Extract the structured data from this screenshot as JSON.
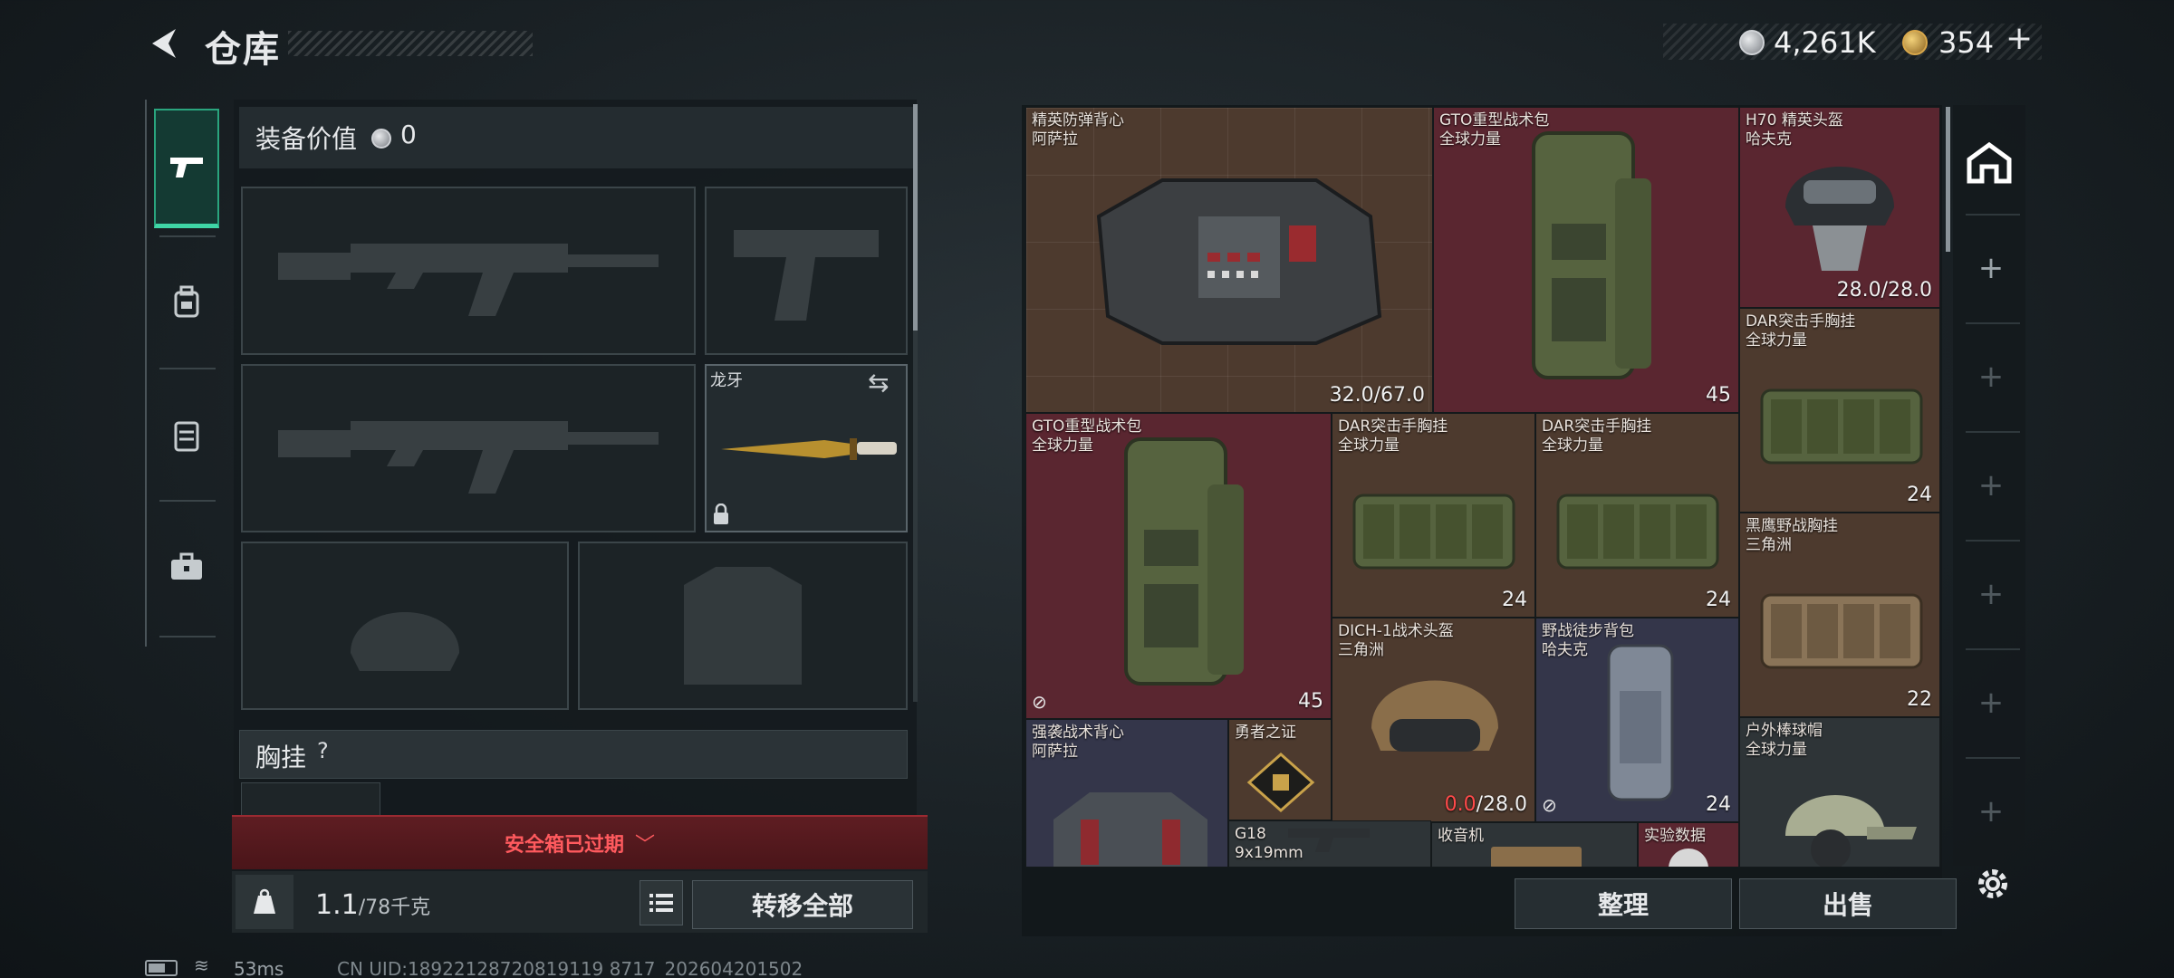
{
  "header": {
    "title": "仓库"
  },
  "currency": {
    "silver": "4,261K",
    "gold": "354",
    "plus": "+"
  },
  "equipment": {
    "value_label": "装备价值",
    "value": "0",
    "knife_name": "龙牙",
    "vest_label": "胸挂",
    "vest_help": "?",
    "safe_box_status": "安全箱已过期",
    "weight_current": "1.1",
    "weight_max": "/78千克",
    "transfer_all": "转移全部"
  },
  "stash": {
    "items": [
      {
        "name1": "精英防弹背心",
        "name2": "阿萨拉",
        "stat": "32.0/67.0",
        "color": "brown"
      },
      {
        "name1": "GTO重型战术包",
        "name2": "全球力量",
        "stat": "45",
        "color": "red"
      },
      {
        "name1": "H70 精英头盔",
        "name2": "哈夫克",
        "stat": "28.0/28.0",
        "color": "red"
      },
      {
        "name1": "DAR突击手胸挂",
        "name2": "全球力量",
        "stat": "24",
        "color": "brown"
      },
      {
        "name1": "GTO重型战术包",
        "name2": "全球力量",
        "stat": "45",
        "color": "red"
      },
      {
        "name1": "DAR突击手胸挂",
        "name2": "全球力量",
        "stat": "24",
        "color": "brown"
      },
      {
        "name1": "DAR突击手胸挂",
        "name2": "全球力量",
        "stat": "24",
        "color": "brown"
      },
      {
        "name1": "黑鹰野战胸挂",
        "name2": "三角洲",
        "stat": "22",
        "color": "brown"
      },
      {
        "name1": "DICH-1战术头盔",
        "name2": "三角洲",
        "stat_red": "0.0",
        "stat": "/28.0",
        "color": "brown"
      },
      {
        "name1": "野战徒步背包",
        "name2": "哈夫克",
        "stat": "24",
        "color": "navy"
      },
      {
        "name1": "户外棒球帽",
        "name2": "全球力量",
        "color": "dark"
      },
      {
        "name1": "强袭战术背心",
        "name2": "阿萨拉",
        "color": "navy"
      },
      {
        "name1": "勇者之证",
        "color": "brown"
      },
      {
        "name1": "G18",
        "name2": "9x19mm",
        "color": "dark"
      },
      {
        "name1": "收音机",
        "color": "dark"
      },
      {
        "name1": "实验数据",
        "color": "red"
      }
    ]
  },
  "actions": {
    "tidy": "整理",
    "sell": "出售"
  },
  "footer": {
    "ping": "53ms",
    "uid": "CN UID:18922128720819119 8717_202604201502"
  },
  "colors": {
    "accent": "#3fd6a6",
    "danger": "#ff5a5e"
  }
}
